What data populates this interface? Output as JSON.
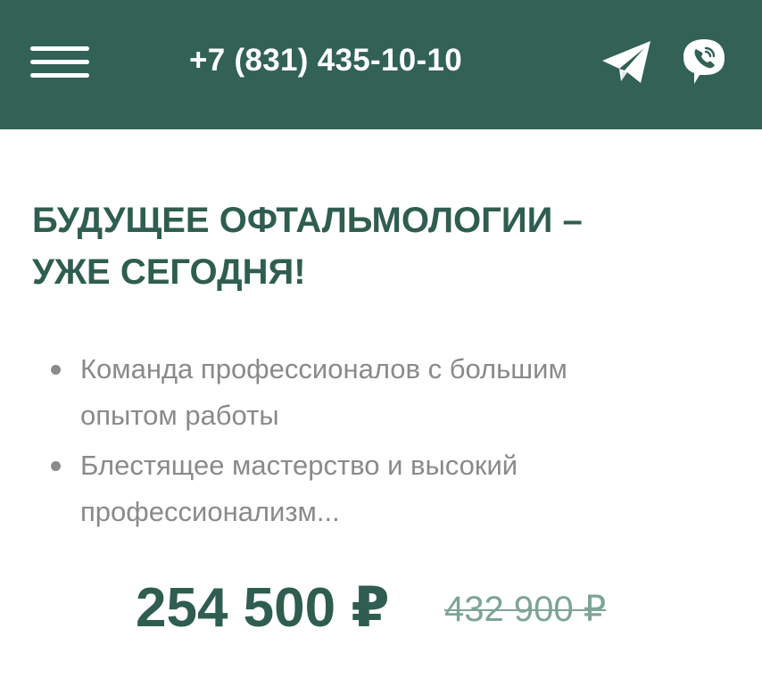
{
  "header": {
    "phone": "+7 (831) 435-10-10",
    "icons": {
      "menu": "hamburger-menu-icon",
      "telegram": "telegram-icon",
      "viber": "viber-icon"
    },
    "background_color": "#326155"
  },
  "hero": {
    "title_line1": "БУДУЩЕЕ ОФТАЛЬМОЛОГИИ –",
    "title_line2": "УЖЕ СЕГОДНЯ!",
    "title_color": "#2f5d50"
  },
  "features": {
    "items": [
      {
        "line1": "Команда профессионалов с большим",
        "line2": "опытом работы"
      },
      {
        "line1": "Блестящее мастерство и высокий",
        "line2": "профессионализм..."
      }
    ],
    "text_color": "#8a8a8a"
  },
  "pricing": {
    "current_price": "254 500 ₽",
    "old_price": "432 900 ₽",
    "current_color": "#2f5d50",
    "old_color": "#7ea496"
  }
}
